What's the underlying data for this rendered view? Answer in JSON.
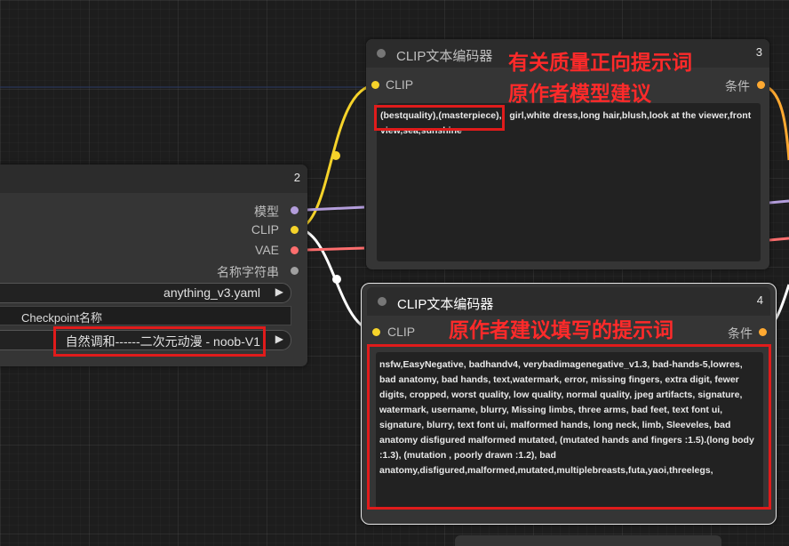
{
  "node3": {
    "title": "CLIP文本编码器",
    "id": "3",
    "input_label": "CLIP",
    "output_label": "条件",
    "prompt_part1": "(bestquality),(masterpiece),",
    "prompt_rest": "girl,white dress,long hair,blush,look at the viewer,front",
    "prompt_line2": "view,sea,sunshine"
  },
  "node4": {
    "title": "CLIP文本编码器",
    "id": "4",
    "input_label": "CLIP",
    "output_label": "条件",
    "prompt": "nsfw,EasyNegative, badhandv4, verybadimagenegative_v1.3, bad-hands-5,lowres, bad anatomy, bad hands, text,watermark, error, missing fingers, extra digit, fewer digits, cropped, worst quality, low quality, normal quality, jpeg artifacts, signature, watermark, username, blurry, Missing limbs, three arms, bad feet, text font ui, signature, blurry, text font ui, malformed hands, long neck, limb, Sleeveles, bad anatomy disfigured malformed mutated, (mutated hands and fingers :1.5).(long body :1.3), (mutation , poorly drawn :1.2), bad anatomy,disfigured,malformed,mutated,multiplebreasts,futa,yaoi,threelegs,"
  },
  "node2": {
    "id": "2",
    "output_model": "模型",
    "output_clip": "CLIP",
    "output_vae": "VAE",
    "output_name": "名称字符串",
    "config_value": "anything_v3.yaml",
    "checkpoint_label": "Checkpoint名称",
    "checkpoint_value": "自然调和------二次元动漫 - noob-V1"
  },
  "annotations": {
    "positive_line1": "有关质量正向提示词",
    "positive_line2": "原作者模型建议",
    "negative": "原作者建议填写的提示词"
  },
  "colors": {
    "clip_yellow": "#f6d32a",
    "model_purple": "#b39ddb",
    "vae_red": "#ff6e6e",
    "string_gray": "#a0a0a0",
    "cond_orange": "#ffa931",
    "annotation_red": "#ff2a2a"
  }
}
